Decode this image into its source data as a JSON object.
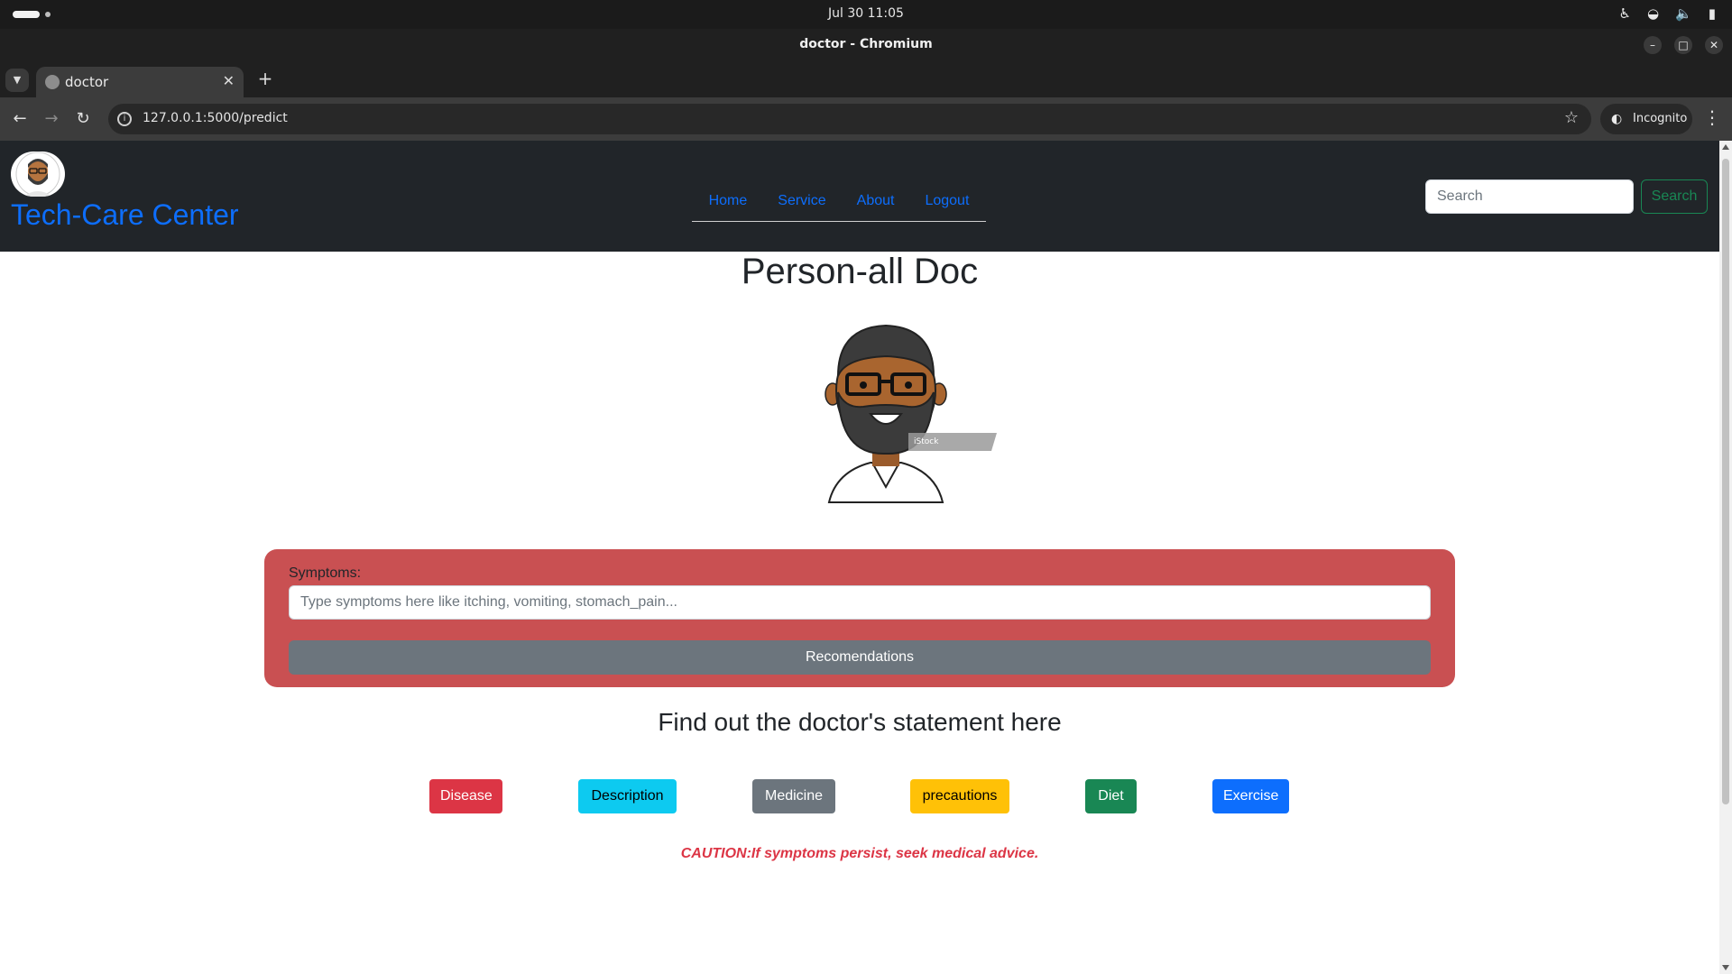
{
  "system": {
    "clock": "Jul 30  11:05",
    "icons": [
      "accessibility-icon",
      "wifi-icon",
      "volume-icon",
      "battery-icon"
    ]
  },
  "window": {
    "title": "doctor - Chromium"
  },
  "browser": {
    "tab_title": "doctor",
    "url": "127.0.0.1:5000/predict",
    "incognito_label": "Incognito"
  },
  "site": {
    "brand": "Tech-Care Center",
    "nav": [
      "Home",
      "Service",
      "About",
      "Logout"
    ],
    "search_placeholder": "Search",
    "search_button": "Search"
  },
  "main": {
    "title": "Person-all Doc",
    "image_watermark": "iStock",
    "symptoms_label": "Symptoms:",
    "symptoms_placeholder": "Type symptoms here like itching, vomiting, stomach_pain...",
    "recommend_button": "Recomendations",
    "statement_heading": "Find out the doctor's statement here",
    "result_buttons": [
      "Disease",
      "Description",
      "Medicine",
      "precautions",
      "Diet",
      "Exercise"
    ],
    "caution": "CAUTION:If symptoms persist, seek medical advice."
  },
  "colors": {
    "brand_blue": "#0d6efd",
    "navbar_bg": "#212529",
    "symptom_panel": "#c95052",
    "danger": "#dc3545",
    "info": "#0dcaf0",
    "secondary": "#6c757d",
    "warning": "#ffc107",
    "success": "#198754"
  }
}
